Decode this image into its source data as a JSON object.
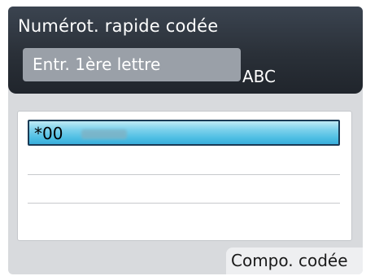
{
  "header": {
    "title": "Numérot. rapide codée",
    "entry_label": "Entr. 1ère lettre",
    "input_mode": "ABC"
  },
  "list": {
    "items": [
      {
        "code": "*00",
        "selected": true
      }
    ]
  },
  "softkey": {
    "label": "Compo. codée"
  }
}
